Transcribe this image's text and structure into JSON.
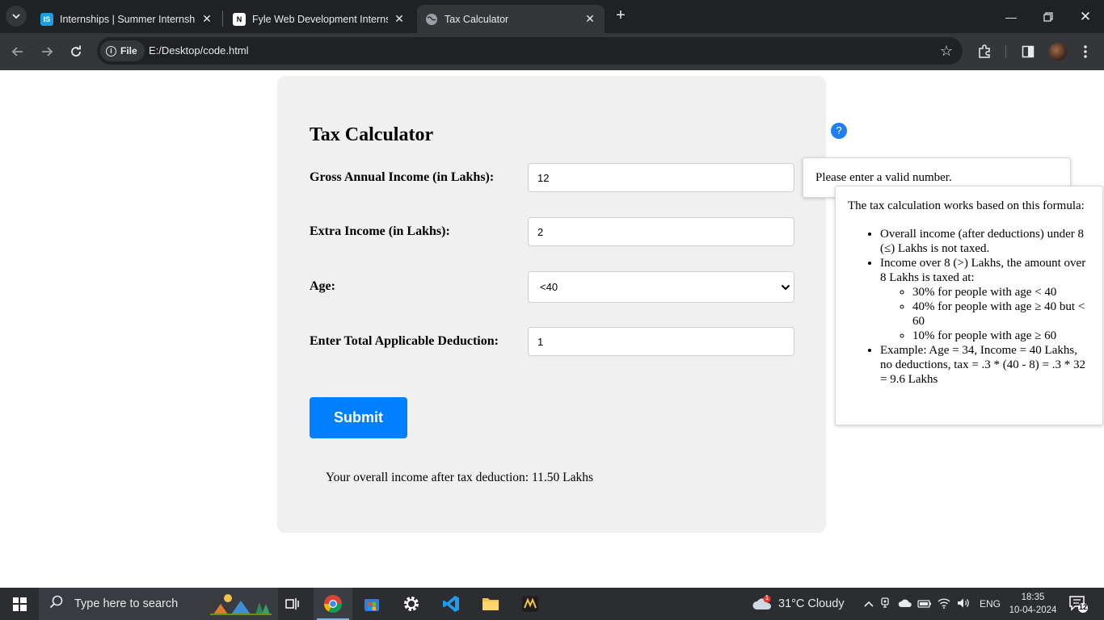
{
  "browser": {
    "tabs": [
      {
        "title": "Internships | Summer Internship",
        "favicon_text": "IS",
        "favicon_color": "#1ba1e2",
        "active": false
      },
      {
        "title": "Fyle Web Development Internshi",
        "favicon_text": "N",
        "favicon_color": "#ffffff",
        "active": false
      },
      {
        "title": "Tax Calculator",
        "favicon_text": "",
        "favicon_color": "#9aa0a6",
        "active": true
      }
    ],
    "chip_label": "File",
    "url": "E:/Desktop/code.html"
  },
  "page": {
    "title": "Tax Calculator",
    "help_icon_text": "?",
    "fields": {
      "gross_label": "Gross Annual Income (in Lakhs):",
      "gross_value": "12",
      "extra_label": "Extra Income (in Lakhs):",
      "extra_value": "2",
      "age_label": "Age:",
      "age_value": "<40",
      "deduction_label": "Enter Total Applicable Deduction:",
      "deduction_value": "1"
    },
    "submit_label": "Submit",
    "result_text": "Your overall income after tax deduction: 11.50 Lakhs",
    "error_tooltip": "Please enter a valid number.",
    "help_tooltip": {
      "intro": "The tax calculation works based on this formula:",
      "rule_1": "Overall income (after deductions) under 8 (≤) Lakhs is not taxed.",
      "rule_2": "Income over 8 (>) Lakhs, the amount over 8 Lakhs is taxed at:",
      "rate_1": "30% for people with age < 40",
      "rate_2": "40% for people with age ≥ 40 but < 60",
      "rate_3": "10% for people with age ≥ 60",
      "example": "Example: Age = 34, Income = 40 Lakhs, no deductions, tax = .3 * (40 - 8) = .3 * 32 = 9.6 Lakhs"
    },
    "colors": {
      "accent": "#0080ff",
      "card": "#f0f0f0",
      "help_icon": "#1f7ff0"
    }
  },
  "taskbar": {
    "search_placeholder": "Type here to search",
    "weather": "31°C  Cloudy",
    "weather_badge": "1",
    "language": "ENG",
    "time": "18:35",
    "date": "10-04-2024",
    "notification_count": "12"
  }
}
